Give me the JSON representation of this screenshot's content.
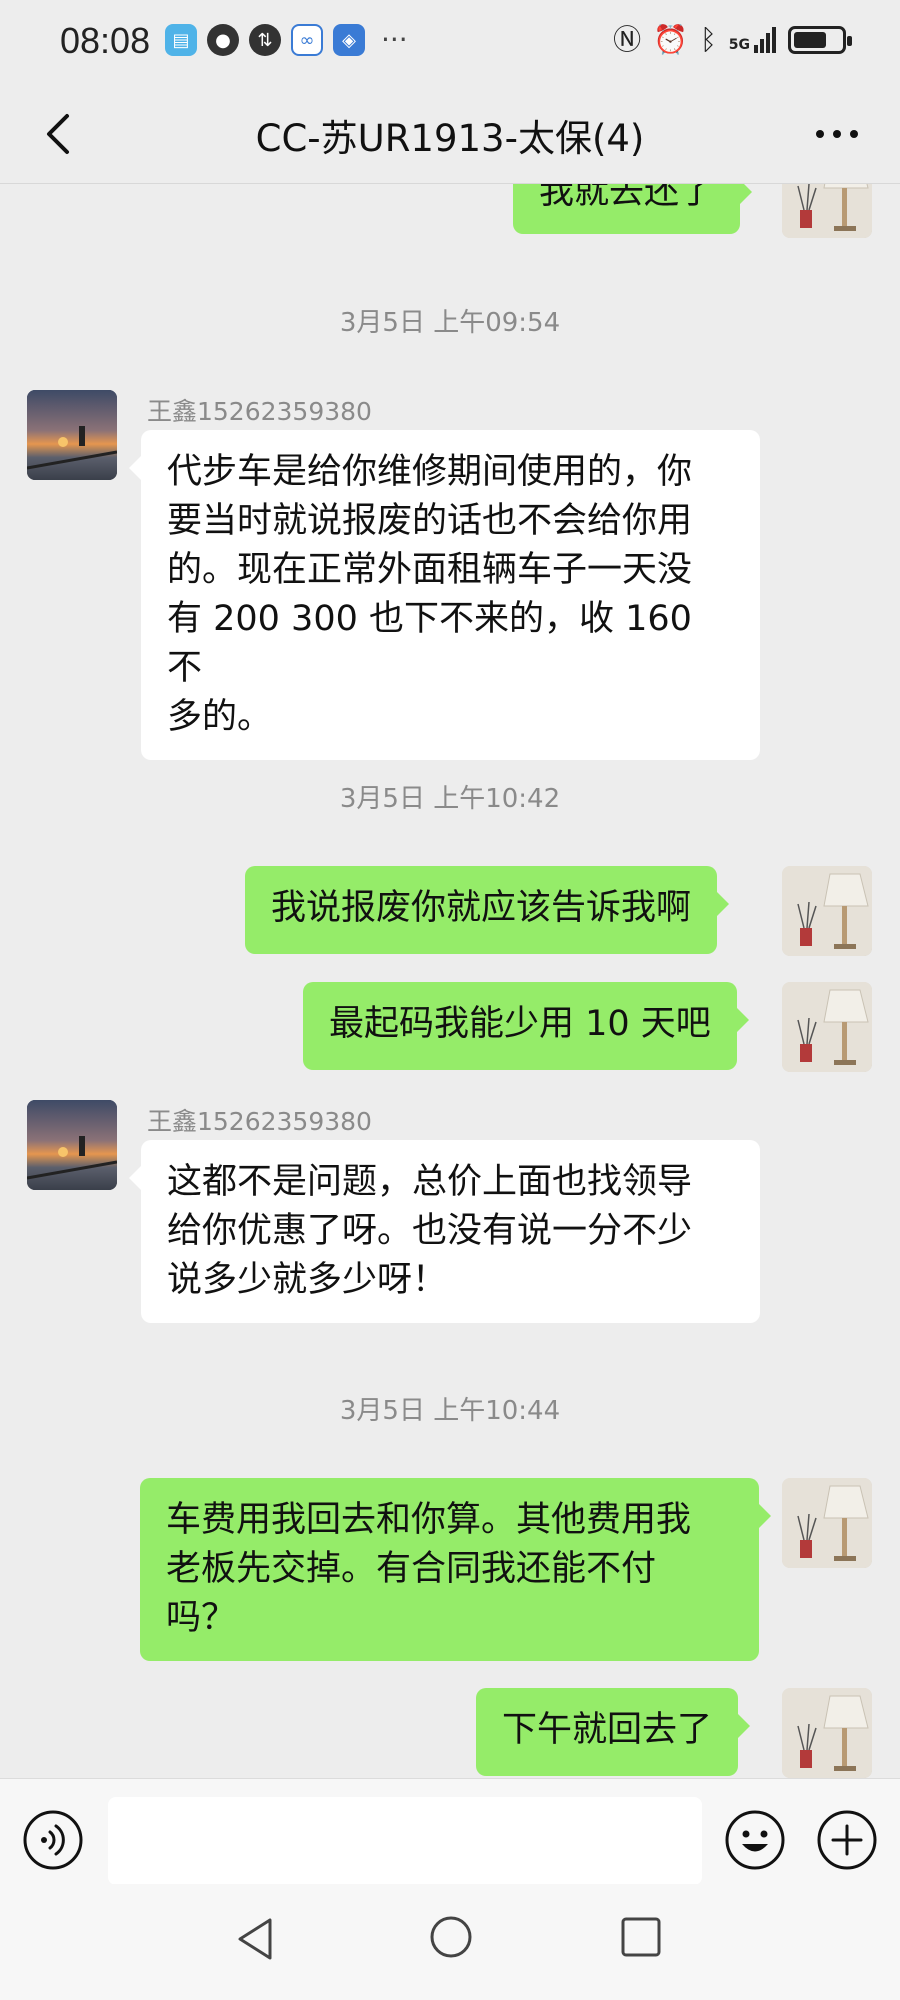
{
  "status_bar": {
    "time": "08:08",
    "left_icons": [
      "book-app-icon",
      "chat-app-icon",
      "vpn-app-icon",
      "cloud-app-icon",
      "security-app-icon"
    ],
    "more": "···",
    "right_icons": [
      "nfc-icon",
      "alarm-icon",
      "bluetooth-icon",
      "5g-signal-icon",
      "battery-icon"
    ],
    "network_label": "5G",
    "battery_level": 0.7
  },
  "header": {
    "title": "CC-苏UR1913-太保(4)",
    "more_label": "···"
  },
  "messages": {
    "m0": {
      "side": "right",
      "text": "我就去还了"
    },
    "t1": "3月5日 上午09:54",
    "m1": {
      "side": "left",
      "sender": "王鑫15262359380",
      "lines": [
        "代步车是给你维修期间使用的，你",
        "要当时就说报废的话也不会给你用",
        "的。现在正常外面租辆车子一天没",
        "有 200 300 也下不来的，收 160 不",
        "多的。"
      ]
    },
    "t2": "3月5日 上午10:42",
    "m2": {
      "side": "right",
      "text": "我说报废你就应该告诉我啊"
    },
    "m3": {
      "side": "right",
      "text": "最起码我能少用 10 天吧"
    },
    "m4": {
      "side": "left",
      "sender": "王鑫15262359380",
      "lines": [
        "这都不是问题，总价上面也找领导",
        "给你优惠了呀。也没有说一分不少",
        "说多少就多少呀！"
      ]
    },
    "t3": "3月5日 上午10:44",
    "m5": {
      "side": "right",
      "lines": [
        "车费用我回去和你算。其他费用我",
        "老板先交掉。有合同我还能不付",
        "吗？"
      ]
    },
    "m6": {
      "side": "right",
      "text": "下午就回去了"
    }
  },
  "input_bar": {
    "value": "",
    "placeholder": ""
  },
  "colors": {
    "background": "#ededed",
    "bubble_sent": "#95ec69",
    "bubble_received": "#ffffff",
    "timestamp": "#8a8a8a"
  }
}
